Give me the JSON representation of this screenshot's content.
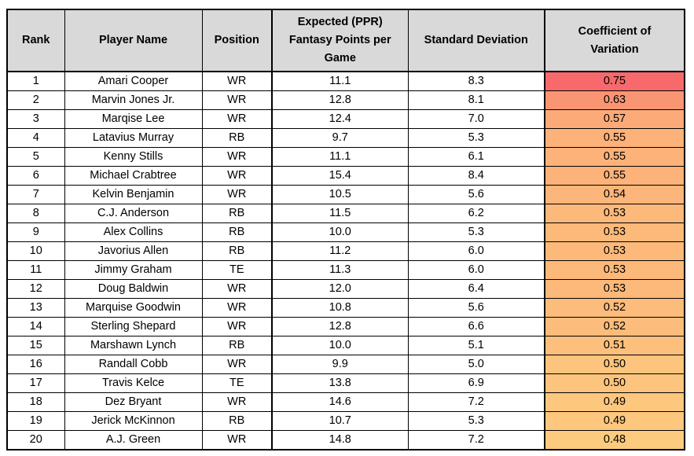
{
  "headers": [
    "Rank",
    "Player Name",
    "Position",
    "Expected (PPR) Fantasy Points per Game",
    "Standard Deviation",
    "Coefficient of Variation"
  ],
  "color_scale": {
    "high": "#F8696B",
    "low": "#FDCB7E"
  },
  "rows": [
    [
      "1",
      "Amari Cooper",
      "WR",
      "11.1",
      "8.3",
      "0.75"
    ],
    [
      "2",
      "Marvin Jones Jr.",
      "WR",
      "12.8",
      "8.1",
      "0.63"
    ],
    [
      "3",
      "Marqise Lee",
      "WR",
      "12.4",
      "7.0",
      "0.57"
    ],
    [
      "4",
      "Latavius Murray",
      "RB",
      "9.7",
      "5.3",
      "0.55"
    ],
    [
      "5",
      "Kenny Stills",
      "WR",
      "11.1",
      "6.1",
      "0.55"
    ],
    [
      "6",
      "Michael Crabtree",
      "WR",
      "15.4",
      "8.4",
      "0.55"
    ],
    [
      "7",
      "Kelvin Benjamin",
      "WR",
      "10.5",
      "5.6",
      "0.54"
    ],
    [
      "8",
      "C.J. Anderson",
      "RB",
      "11.5",
      "6.2",
      "0.53"
    ],
    [
      "9",
      "Alex Collins",
      "RB",
      "10.0",
      "5.3",
      "0.53"
    ],
    [
      "10",
      "Javorius Allen",
      "RB",
      "11.2",
      "6.0",
      "0.53"
    ],
    [
      "11",
      "Jimmy Graham",
      "TE",
      "11.3",
      "6.0",
      "0.53"
    ],
    [
      "12",
      "Doug Baldwin",
      "WR",
      "12.0",
      "6.4",
      "0.53"
    ],
    [
      "13",
      "Marquise Goodwin",
      "WR",
      "10.8",
      "5.6",
      "0.52"
    ],
    [
      "14",
      "Sterling Shepard",
      "WR",
      "12.8",
      "6.6",
      "0.52"
    ],
    [
      "15",
      "Marshawn Lynch",
      "RB",
      "10.0",
      "5.1",
      "0.51"
    ],
    [
      "16",
      "Randall Cobb",
      "WR",
      "9.9",
      "5.0",
      "0.50"
    ],
    [
      "17",
      "Travis Kelce",
      "TE",
      "13.8",
      "6.9",
      "0.50"
    ],
    [
      "18",
      "Dez Bryant",
      "WR",
      "14.6",
      "7.2",
      "0.49"
    ],
    [
      "19",
      "Jerick McKinnon",
      "RB",
      "10.7",
      "5.3",
      "0.49"
    ],
    [
      "20",
      "A.J. Green",
      "WR",
      "14.8",
      "7.2",
      "0.48"
    ]
  ]
}
